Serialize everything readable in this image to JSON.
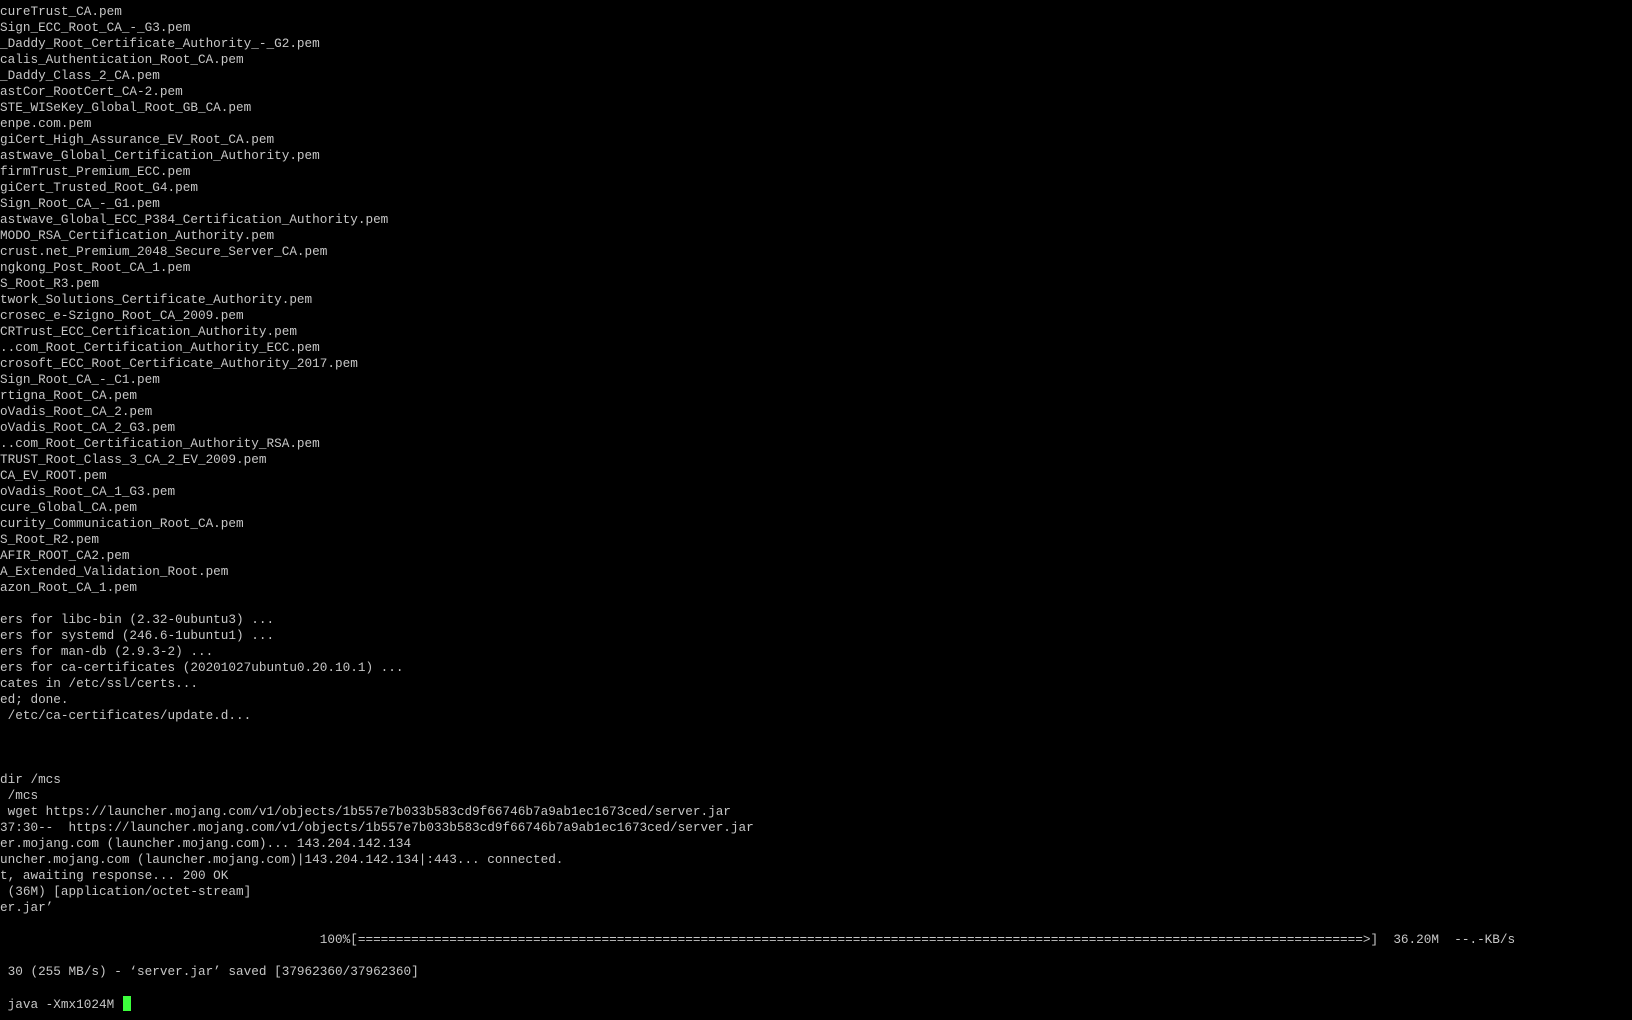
{
  "terminal": {
    "lines": [
      "cureTrust_CA.pem",
      "Sign_ECC_Root_CA_-_G3.pem",
      "_Daddy_Root_Certificate_Authority_-_G2.pem",
      "calis_Authentication_Root_CA.pem",
      "_Daddy_Class_2_CA.pem",
      "astCor_RootCert_CA-2.pem",
      "STE_WISeKey_Global_Root_GB_CA.pem",
      "enpe.com.pem",
      "giCert_High_Assurance_EV_Root_CA.pem",
      "astwave_Global_Certification_Authority.pem",
      "firmTrust_Premium_ECC.pem",
      "giCert_Trusted_Root_G4.pem",
      "Sign_Root_CA_-_G1.pem",
      "astwave_Global_ECC_P384_Certification_Authority.pem",
      "MODO_RSA_Certification_Authority.pem",
      "crust.net_Premium_2048_Secure_Server_CA.pem",
      "ngkong_Post_Root_CA_1.pem",
      "S_Root_R3.pem",
      "twork_Solutions_Certificate_Authority.pem",
      "crosec_e-Szigno_Root_CA_2009.pem",
      "CRTrust_ECC_Certification_Authority.pem",
      "..com_Root_Certification_Authority_ECC.pem",
      "crosoft_ECC_Root_Certificate_Authority_2017.pem",
      "Sign_Root_CA_-_C1.pem",
      "rtigna_Root_CA.pem",
      "oVadis_Root_CA_2.pem",
      "oVadis_Root_CA_2_G3.pem",
      "..com_Root_Certification_Authority_RSA.pem",
      "TRUST_Root_Class_3_CA_2_EV_2009.pem",
      "CA_EV_ROOT.pem",
      "oVadis_Root_CA_1_G3.pem",
      "cure_Global_CA.pem",
      "curity_Communication_Root_CA.pem",
      "S_Root_R2.pem",
      "AFIR_ROOT_CA2.pem",
      "A_Extended_Validation_Root.pem",
      "azon_Root_CA_1.pem",
      "",
      "ers for libc-bin (2.32-0ubuntu3) ...",
      "ers for systemd (246.6-1ubuntu1) ...",
      "ers for man-db (2.9.3-2) ...",
      "ers for ca-certificates (20201027ubuntu0.20.10.1) ...",
      "cates in /etc/ssl/certs...",
      "ed; done.",
      " /etc/ca-certificates/update.d...",
      "",
      "",
      "",
      "dir /mcs",
      " /mcs",
      " wget https://launcher.mojang.com/v1/objects/1b557e7b033b583cd9f66746b7a9ab1ec1673ced/server.jar",
      "37:30--  https://launcher.mojang.com/v1/objects/1b557e7b033b583cd9f66746b7a9ab1ec1673ced/server.jar",
      "er.mojang.com (launcher.mojang.com)... 143.204.142.134",
      "uncher.mojang.com (launcher.mojang.com)|143.204.142.134|:443... connected.",
      "t, awaiting response... 200 OK",
      " (36M) [application/octet-stream]",
      "er.jar’",
      "",
      "                                          100%[====================================================================================================================================>]  36.20M  --.-KB/s",
      "",
      " 30 (255 MB/s) - ‘server.jar’ saved [37962360/37962360]",
      ""
    ],
    "prompt_line": " java -Xmx1024M ",
    "colors": {
      "background": "#000000",
      "foreground": "#c7c7c7",
      "cursor": "#3cff3c"
    }
  }
}
